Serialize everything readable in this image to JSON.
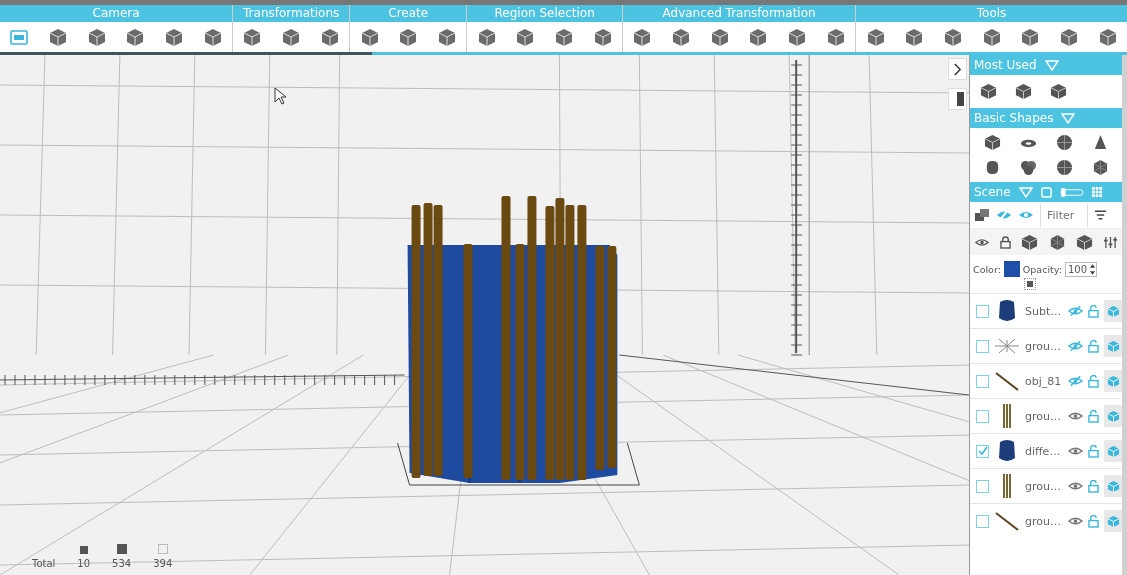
{
  "toolbar": {
    "sections": [
      {
        "label": "Camera",
        "tools": [
          {
            "selected": true
          },
          {
            "selected": false
          },
          {
            "selected": false
          },
          {
            "selected": false
          },
          {
            "selected": false
          },
          {
            "selected": false
          }
        ]
      },
      {
        "label": "Transformations",
        "tools": [
          {
            "selected": false
          },
          {
            "selected": false
          },
          {
            "selected": false
          }
        ]
      },
      {
        "label": "Create",
        "tools": [
          {
            "selected": false
          },
          {
            "selected": false
          },
          {
            "selected": false
          }
        ]
      },
      {
        "label": "Region Selection",
        "tools": [
          {
            "selected": false
          },
          {
            "selected": false
          },
          {
            "selected": false
          },
          {
            "selected": false
          }
        ]
      },
      {
        "label": "Advanced Transformation",
        "tools": [
          {
            "selected": false
          },
          {
            "selected": false
          },
          {
            "selected": false
          },
          {
            "selected": false
          },
          {
            "selected": false
          },
          {
            "selected": false
          }
        ]
      },
      {
        "label": "Tools",
        "tools": [
          {
            "selected": false
          },
          {
            "selected": false
          },
          {
            "selected": false
          },
          {
            "selected": false
          },
          {
            "selected": false
          },
          {
            "selected": false
          },
          {
            "selected": false
          }
        ]
      }
    ]
  },
  "progress": {
    "level": 0.33
  },
  "side_panel": {
    "most_used": {
      "title": "Most Used"
    },
    "basic_shapes": {
      "title": "Basic Shapes"
    },
    "scene": {
      "title": "Scene",
      "filter": {
        "placeholder": "Filter"
      },
      "color_label": "Color:",
      "color": "#1f4ea8",
      "opacity_label": "Opacity:",
      "opacity": "100",
      "layers": [
        {
          "name": "Subt…",
          "kind": "blob",
          "checked": false,
          "hidden": true
        },
        {
          "name": "grou…",
          "kind": "star",
          "checked": false,
          "hidden": true
        },
        {
          "name": "obj_81",
          "kind": "stick",
          "checked": false,
          "hidden": true
        },
        {
          "name": "grou…",
          "kind": "bars",
          "checked": false,
          "hidden": false
        },
        {
          "name": "diffe…",
          "kind": "blob",
          "checked": true,
          "hidden": false
        },
        {
          "name": "grou…",
          "kind": "bars",
          "checked": false,
          "hidden": false
        },
        {
          "name": "grou…",
          "kind": "stick",
          "checked": false,
          "hidden": false
        }
      ]
    }
  },
  "stats": {
    "label": "Total",
    "counts": [
      {
        "kind": "small",
        "value": "10"
      },
      {
        "kind": "large",
        "value": "534"
      },
      {
        "kind": "outline",
        "value": "394"
      }
    ]
  }
}
